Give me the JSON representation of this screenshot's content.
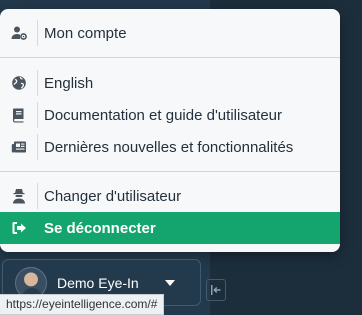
{
  "menu": {
    "items": [
      {
        "label": "Mon compte",
        "icon": "user-gear-icon"
      },
      {
        "label": "English",
        "icon": "globe-icon"
      },
      {
        "label": "Documentation et guide d'utilisateur",
        "icon": "book-icon"
      },
      {
        "label": "Dernières nouvelles et fonctionnalités",
        "icon": "newspaper-icon"
      },
      {
        "label": "Changer d'utilisateur",
        "icon": "user-secret-icon"
      },
      {
        "label": "Se déconnecter",
        "icon": "sign-out-icon"
      }
    ]
  },
  "user": {
    "name": "Demo Eye-In"
  },
  "status_bar": {
    "url": "https://eyeintelligence.com/#"
  },
  "colors": {
    "accent": "#14a56f",
    "sidebar_bg": "#233a4c"
  }
}
